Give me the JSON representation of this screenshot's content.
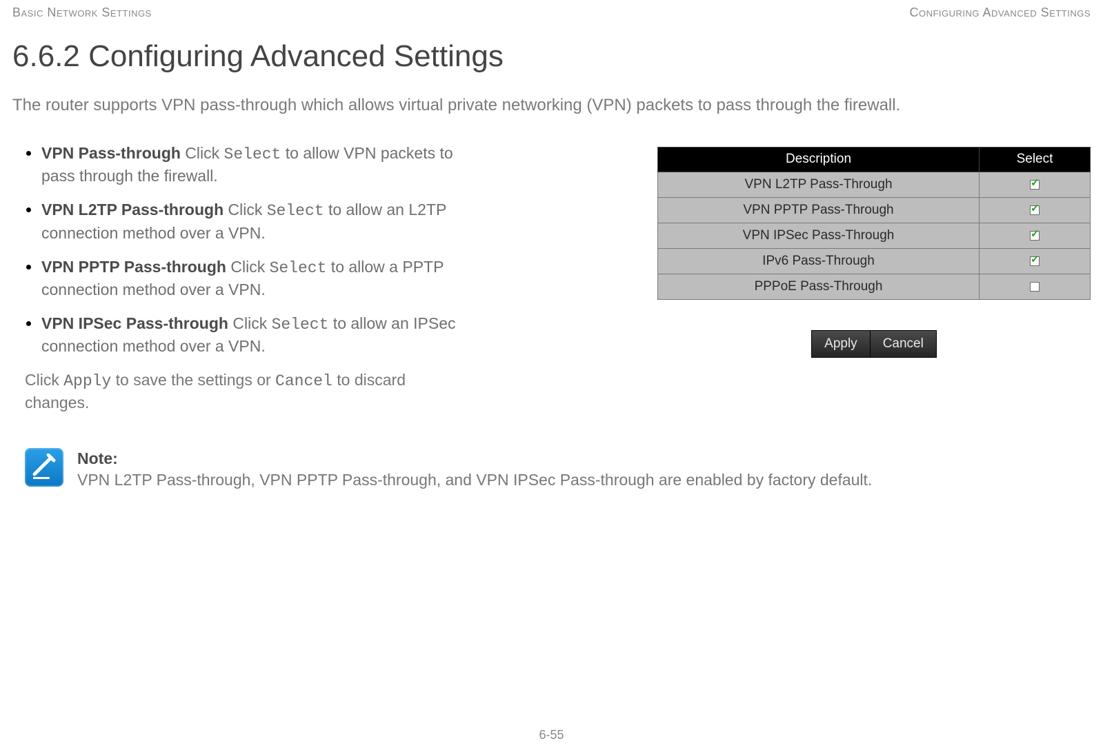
{
  "header": {
    "left": "Basic Network Settings",
    "right": "Configuring Advanced Settings"
  },
  "title": "6.6.2 Configuring Advanced Settings",
  "intro": "The router supports VPN pass-through which allows virtual private networking (VPN) packets to pass through the firewall.",
  "bullets": [
    {
      "term": "VPN Pass-through",
      "pre": "  Click ",
      "code": "Select",
      "post": " to allow VPN packets to pass through the firewall."
    },
    {
      "term": "VPN L2TP Pass-through",
      "pre": "  Click ",
      "code": "Select",
      "post": " to allow an L2TP connection method over a VPN."
    },
    {
      "term": "VPN PPTP Pass-through",
      "pre": "  Click ",
      "code": "Select",
      "post": " to allow a PPTP connection method over a VPN."
    },
    {
      "term": "VPN IPSec Pass-through",
      "pre": "  Click ",
      "code": "Select",
      "post": " to allow an IPSec connection method over a VPN."
    }
  ],
  "apply_sentence": {
    "pre": "Click ",
    "code1": "Apply",
    "mid": " to save the settings or ",
    "code2": "Cancel",
    "post": " to discard changes."
  },
  "table": {
    "headers": {
      "desc": "Description",
      "select": "Select"
    },
    "rows": [
      {
        "desc": "VPN L2TP Pass-Through",
        "checked": true
      },
      {
        "desc": "VPN PPTP Pass-Through",
        "checked": true
      },
      {
        "desc": "VPN IPSec Pass-Through",
        "checked": true
      },
      {
        "desc": "IPv6 Pass-Through",
        "checked": true
      },
      {
        "desc": "PPPoE Pass-Through",
        "checked": false
      }
    ]
  },
  "buttons": {
    "apply": "Apply",
    "cancel": "Cancel"
  },
  "note": {
    "label": "Note:",
    "text": "VPN L2TP Pass-through, VPN PPTP Pass-through, and VPN IPSec Pass-through are enabled by factory default."
  },
  "footer": "6-55"
}
